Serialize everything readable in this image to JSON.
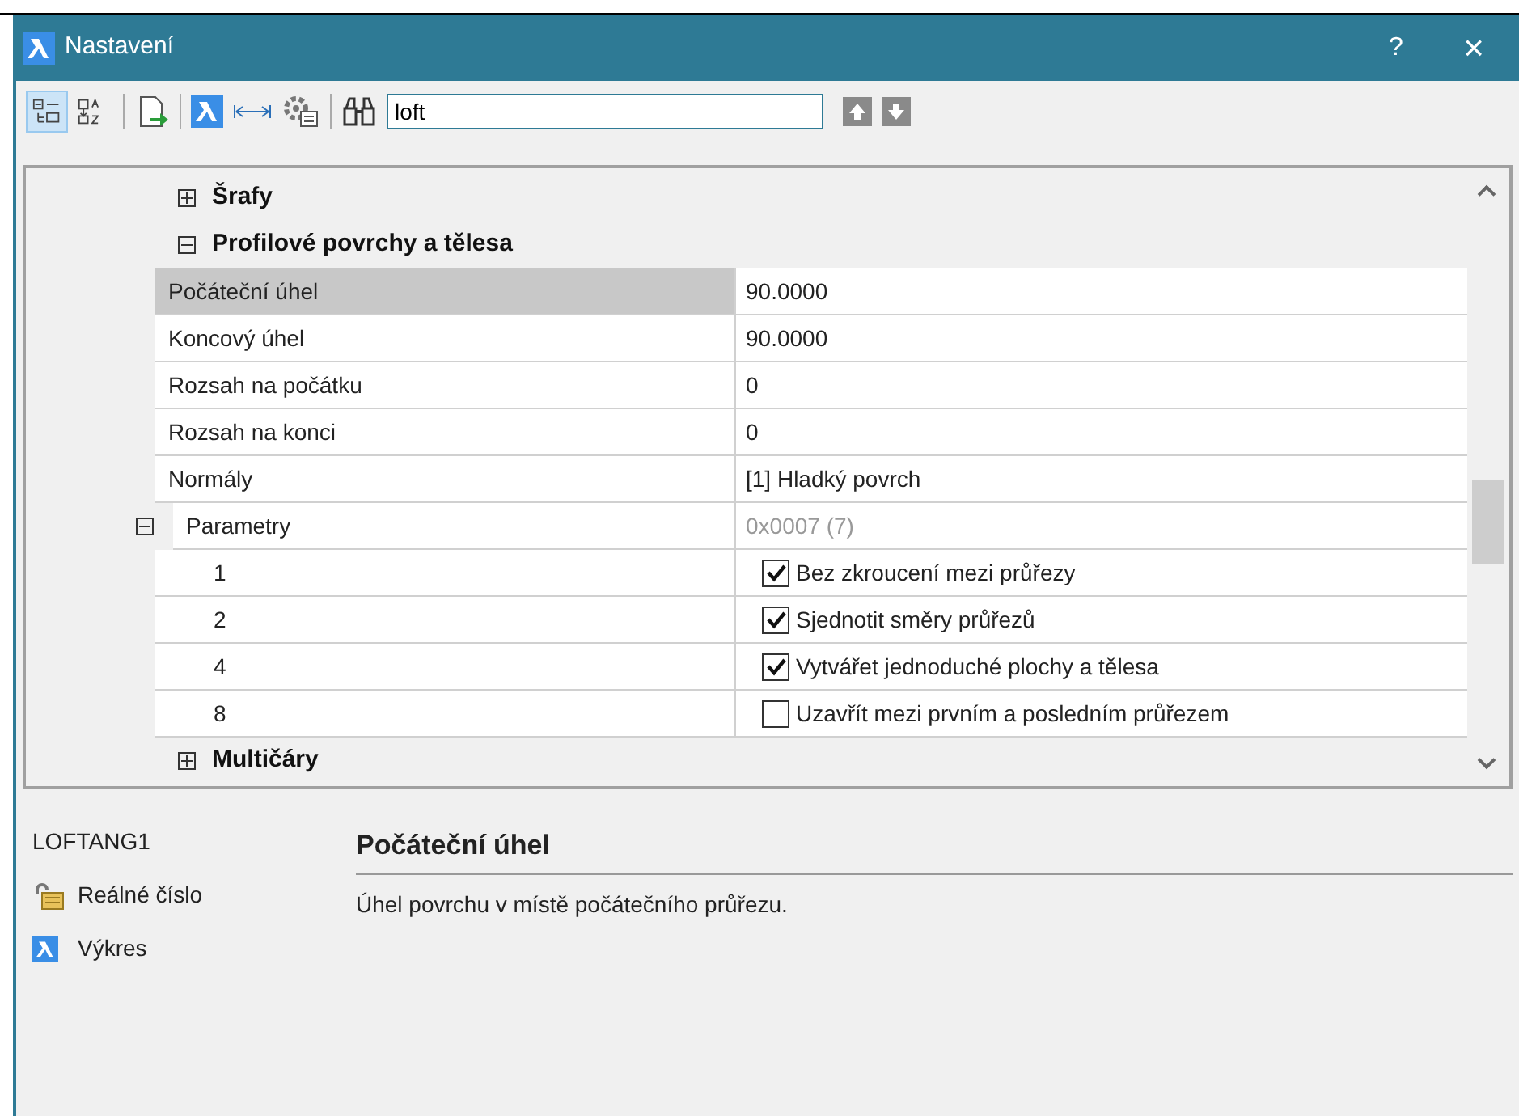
{
  "window": {
    "title": "Nastavení",
    "help": "?",
    "close": "×"
  },
  "toolbar": {
    "view_buttons": [
      {
        "kind": "categorized",
        "selected": true
      },
      {
        "kind": "alphabetical",
        "selected": false
      }
    ],
    "search": {
      "value": "loft"
    }
  },
  "grid": {
    "sections": [
      {
        "label": "Šrafy",
        "expanded": false
      },
      {
        "label": "Profilové povrchy a tělesa",
        "expanded": true,
        "properties": [
          {
            "kind": "value",
            "name": "Počáteční úhel",
            "value": "90.0000",
            "selected": true
          },
          {
            "kind": "value",
            "name": "Koncový úhel",
            "value": "90.0000",
            "selected": false
          },
          {
            "kind": "value",
            "name": "Rozsah na počátku",
            "value": "0",
            "selected": false
          },
          {
            "kind": "value",
            "name": "Rozsah na konci",
            "value": "0",
            "selected": false
          },
          {
            "kind": "value",
            "name": "Normály",
            "value": "[1] Hladký povrch",
            "selected": false
          },
          {
            "kind": "flags",
            "name": "Parametry",
            "value": "0x0007 (7)",
            "selected": false,
            "expanded": true,
            "children": [
              {
                "name": "1",
                "label": "Bez zkroucení mezi průřezy",
                "checked": true,
                "selected": false
              },
              {
                "name": "2",
                "label": "Sjednotit směry průřezů",
                "checked": true,
                "selected": false
              },
              {
                "name": "4",
                "label": "Vytvářet jednoduché plochy a tělesa",
                "checked": true,
                "selected": false
              },
              {
                "name": "8",
                "label": "Uzavřít mezi prvním a posledním průřezem",
                "checked": false,
                "selected": false
              }
            ]
          }
        ]
      },
      {
        "label": "Multičáry",
        "expanded": false
      }
    ]
  },
  "info": {
    "variable": "LOFTANG1",
    "type": "Reálné číslo",
    "scope": "Výkres",
    "title": "Počáteční úhel",
    "description": "Úhel povrchu v místě počátečního průřezu."
  }
}
